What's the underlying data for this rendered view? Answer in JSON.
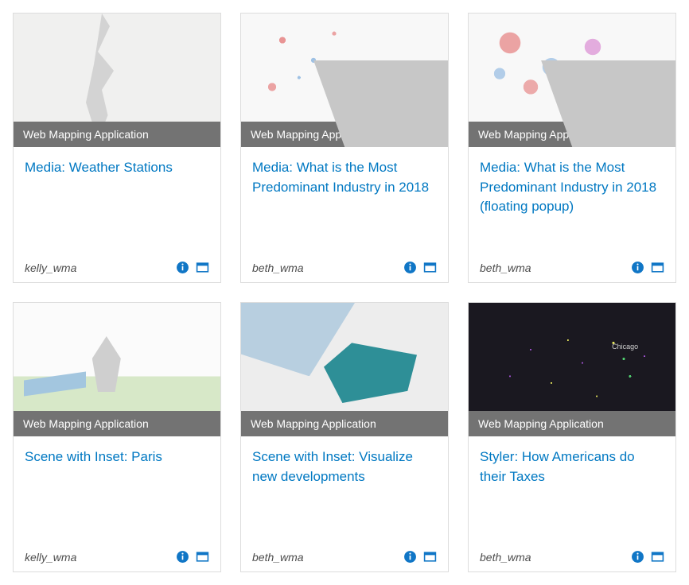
{
  "type_label": "Web Mapping Application",
  "items": [
    {
      "title": "Media: Weather Stations",
      "owner": "kelly_wma"
    },
    {
      "title": "Media: What is the Most Predominant Industry in 2018",
      "owner": "beth_wma"
    },
    {
      "title": "Media: What is the Most Predominant Industry in 2018 (floating popup)",
      "owner": "beth_wma"
    },
    {
      "title": "Scene with Inset: Paris",
      "owner": "kelly_wma"
    },
    {
      "title": "Scene with Inset: Visualize new developments",
      "owner": "beth_wma"
    },
    {
      "title": "Styler: How Americans do their Taxes",
      "owner": "beth_wma"
    }
  ],
  "icons": {
    "info": "info-icon",
    "open": "open-icon"
  }
}
